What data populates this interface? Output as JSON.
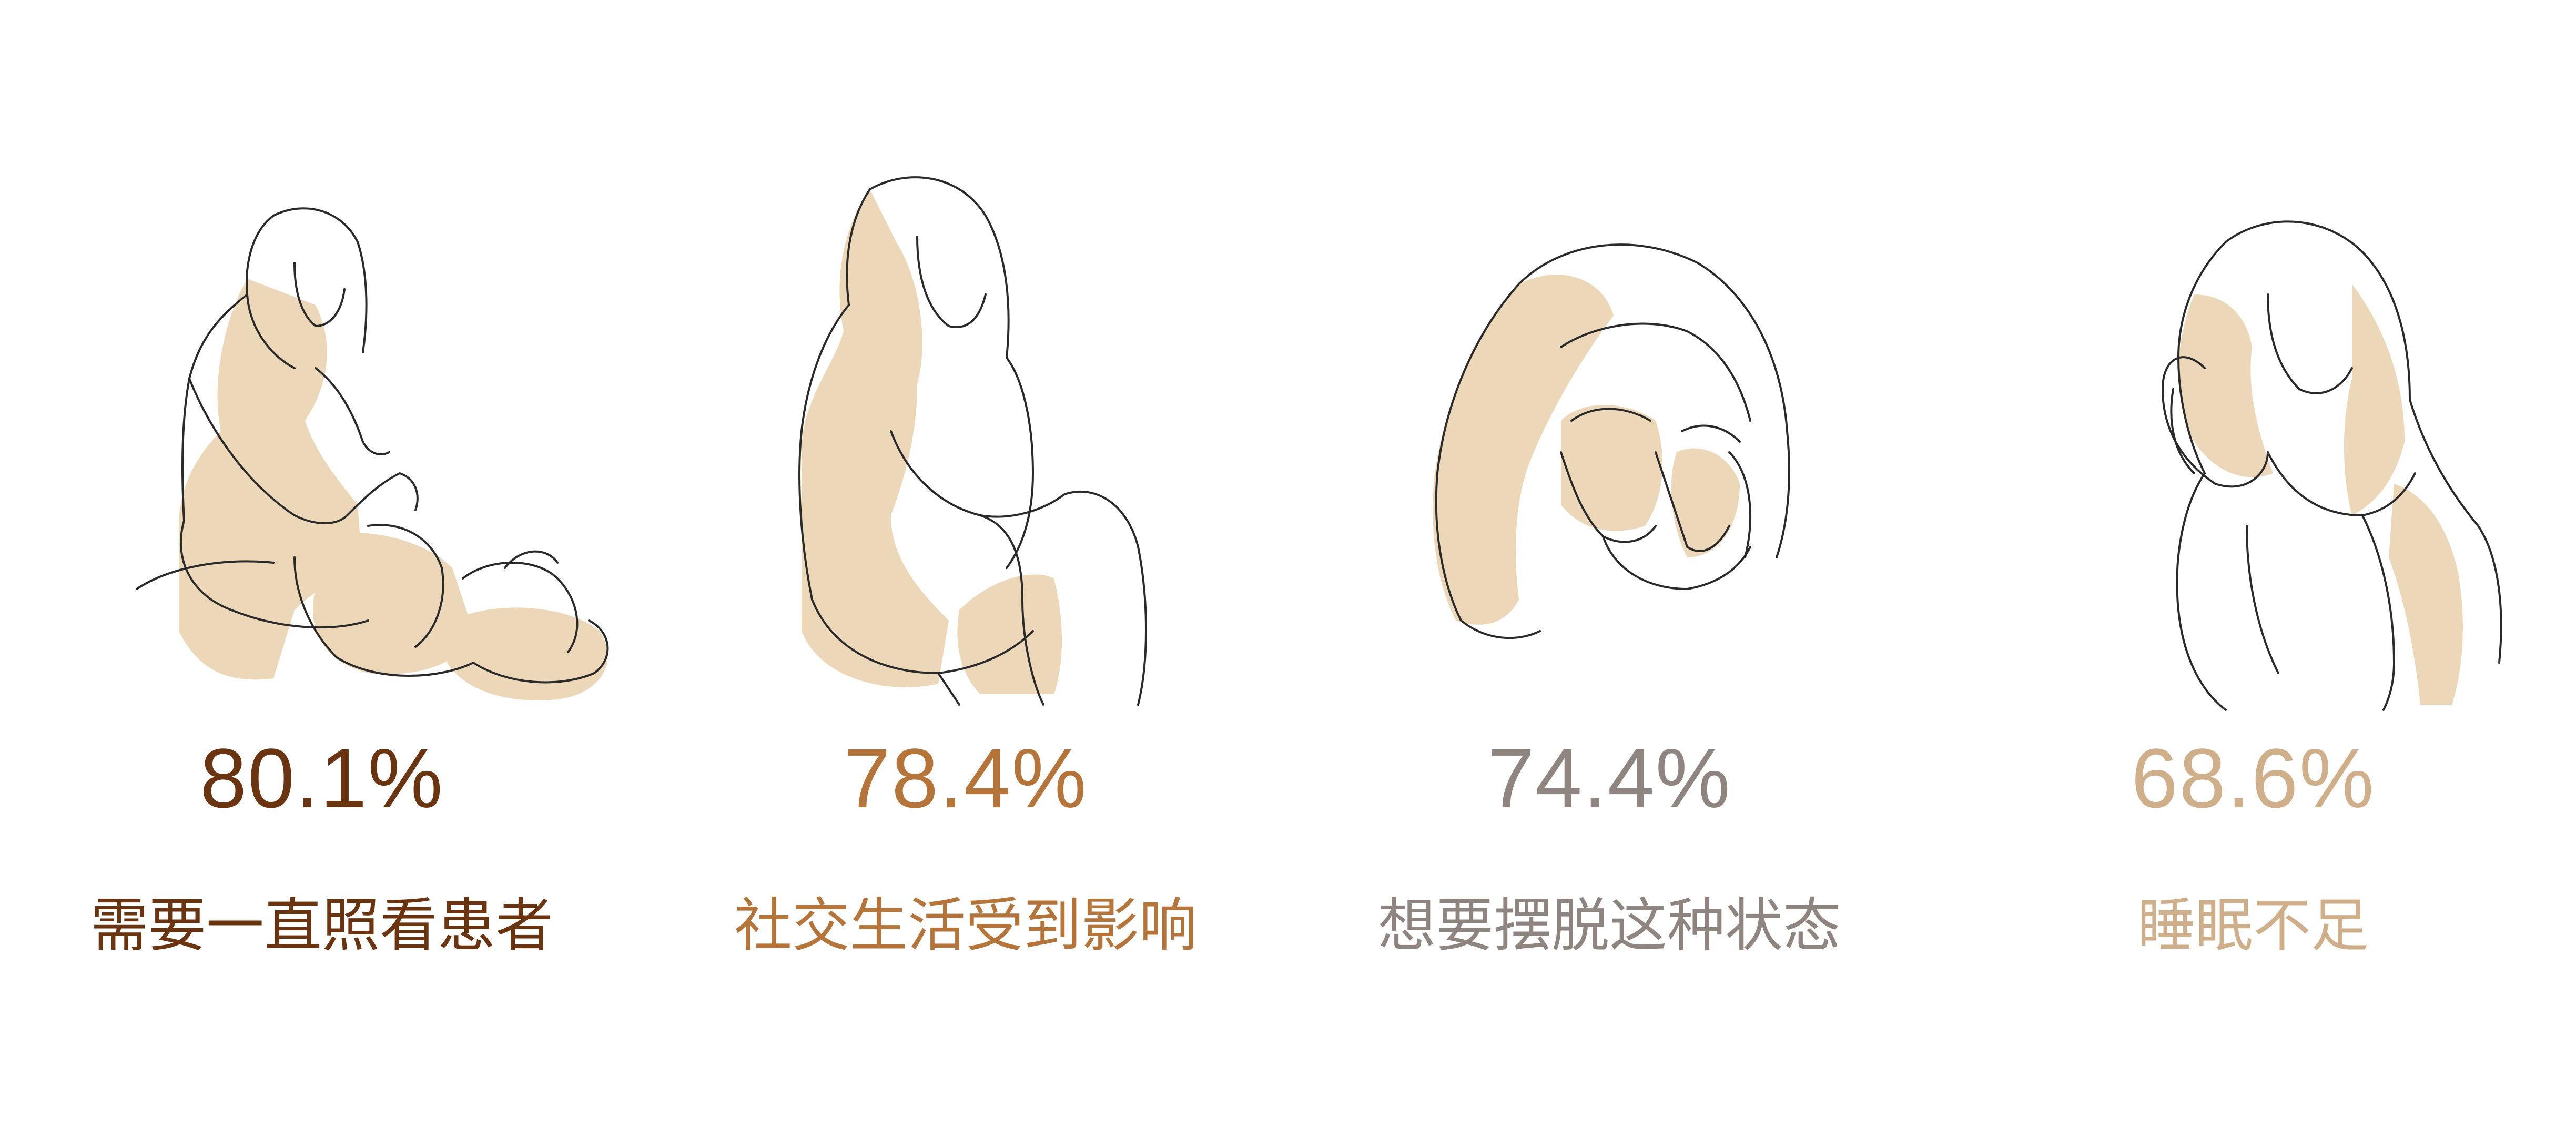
{
  "stats": [
    {
      "percent": "80.1%",
      "label": "需要一直照看患者",
      "color": "#6b3410",
      "icon": "woman-caring-for-patient-illustration"
    },
    {
      "percent": "78.4%",
      "label": "社交生活受到影响",
      "color": "#b5753a",
      "icon": "woman-sitting-alone-illustration"
    },
    {
      "percent": "74.4%",
      "label": "想要摆脱这种状态",
      "color": "#8f8580",
      "icon": "woman-crying-illustration"
    },
    {
      "percent": "68.6%",
      "label": "睡眠不足",
      "color": "#cfae8a",
      "icon": "woman-holding-head-illustration"
    }
  ],
  "colors": {
    "skin_fill": "#ecd7b8",
    "line": "#2a2a2a"
  }
}
